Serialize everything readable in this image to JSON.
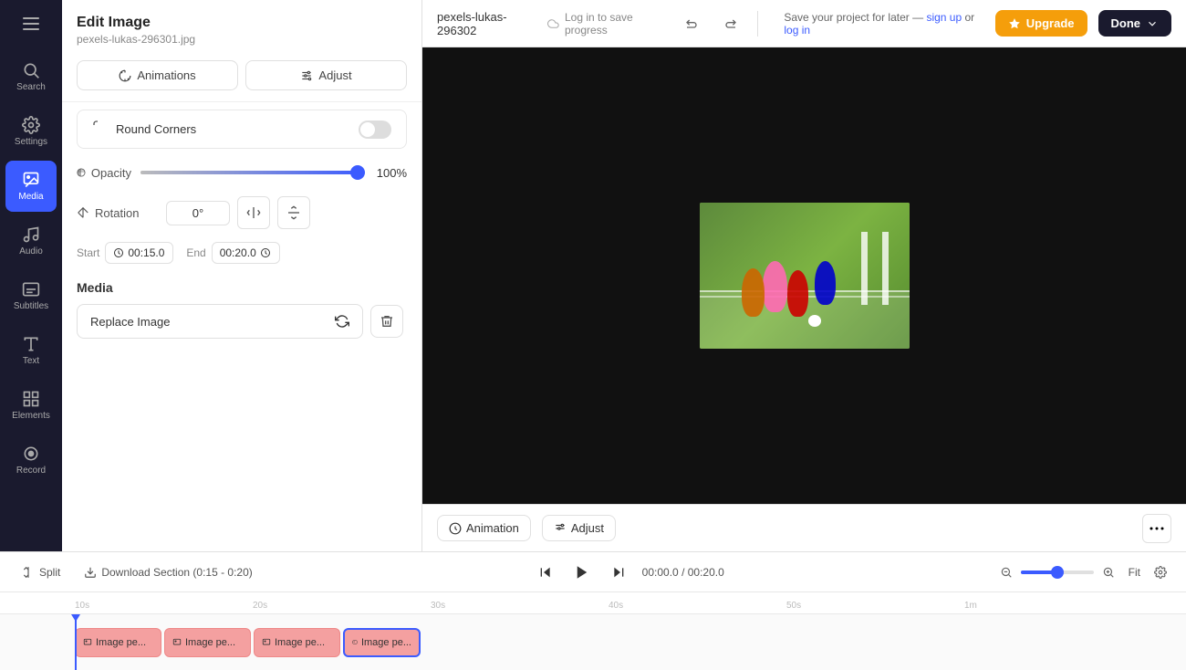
{
  "app": {
    "menu_icon": "☰"
  },
  "sidebar": {
    "items": [
      {
        "id": "search",
        "label": "Search",
        "icon": "search"
      },
      {
        "id": "settings",
        "label": "Settings",
        "icon": "settings"
      },
      {
        "id": "media",
        "label": "Media",
        "icon": "media",
        "active": true
      },
      {
        "id": "audio",
        "label": "Audio",
        "icon": "audio"
      },
      {
        "id": "subtitles",
        "label": "Subtitles",
        "icon": "subtitles"
      },
      {
        "id": "text",
        "label": "Text",
        "icon": "text"
      },
      {
        "id": "elements",
        "label": "Elements",
        "icon": "elements"
      },
      {
        "id": "record",
        "label": "Record",
        "icon": "record"
      }
    ]
  },
  "panel": {
    "title": "Edit Image",
    "subtitle": "pexels-lukas-296301.jpg",
    "tabs": [
      {
        "id": "animations",
        "label": "Animations"
      },
      {
        "id": "adjust",
        "label": "Adjust"
      }
    ],
    "round_corners": {
      "label": "Round Corners",
      "enabled": false
    },
    "opacity": {
      "label": "Opacity",
      "value": "100%",
      "percent": 100
    },
    "rotation": {
      "label": "Rotation",
      "value": "0°"
    },
    "start": {
      "label": "Start",
      "value": "00:15.0"
    },
    "end": {
      "label": "End",
      "value": "00:20.0"
    },
    "media_section": {
      "title": "Media",
      "replace_label": "Replace Image"
    }
  },
  "topbar": {
    "filename": "pexels-lukas-296302",
    "save_notice": "Log in to save progress",
    "save_project_prefix": "Save your project for later —",
    "sign_up": "sign up",
    "or": "or",
    "log_in": "log in",
    "upgrade_label": "Upgrade",
    "done_label": "Done"
  },
  "bottom_toolbar": {
    "animation_label": "Animation",
    "adjust_label": "Adjust"
  },
  "timeline": {
    "split_label": "Split",
    "download_section_label": "Download Section (0:15 - 0:20)",
    "current_time": "00:00.0",
    "total_time": "00:20.0",
    "fit_label": "Fit",
    "ruler_marks": [
      "",
      "10s",
      "",
      "20s",
      "",
      "30s",
      "",
      "40s",
      "",
      "50s",
      "",
      "1m"
    ],
    "tracks": [
      {
        "label": "Image pe...",
        "active": false
      },
      {
        "label": "Image pe...",
        "active": false
      },
      {
        "label": "Image pe...",
        "active": false
      },
      {
        "label": "Image pe...",
        "active": true
      }
    ]
  }
}
